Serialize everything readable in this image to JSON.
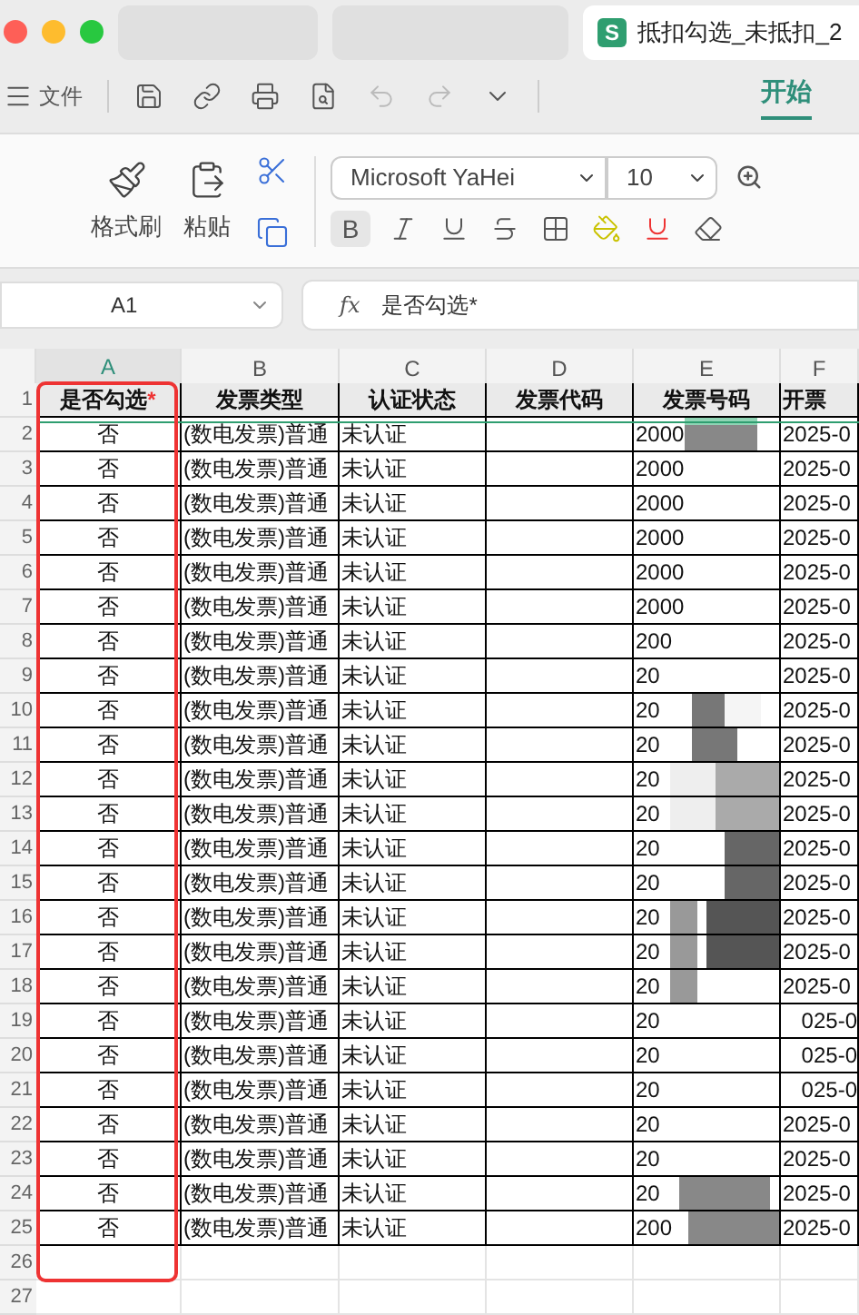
{
  "window": {
    "tab_title": "抵扣勾选_未抵扣_2",
    "app_badge": "S"
  },
  "menu": {
    "file_label": "文件",
    "ribbon_tabs": [
      {
        "label": "开始",
        "selected": true
      }
    ]
  },
  "ribbon": {
    "format_painter": "格式刷",
    "paste": "粘贴",
    "font": "Microsoft YaHei",
    "size": "10",
    "bold": "B"
  },
  "formula_bar": {
    "cell_ref": "A1",
    "fx": "fx",
    "value": "是否勾选*"
  },
  "columns": [
    {
      "letter": "A",
      "selected": true
    },
    {
      "letter": "B",
      "selected": false
    },
    {
      "letter": "C",
      "selected": false
    },
    {
      "letter": "D",
      "selected": false
    },
    {
      "letter": "E",
      "selected": false
    },
    {
      "letter": "F",
      "selected": false
    }
  ],
  "header_row": {
    "number": "1",
    "cells": [
      {
        "text": "是否勾选",
        "required_mark": "*"
      },
      {
        "text": "发票类型"
      },
      {
        "text": "认证状态"
      },
      {
        "text": "发票代码"
      },
      {
        "text": "发票号码"
      },
      {
        "text": "开票"
      }
    ]
  },
  "rows": [
    {
      "number": "2",
      "a": "否",
      "b": "(数电发票)普通",
      "c": "未认证",
      "e": "2000",
      "f": "2025-0"
    },
    {
      "number": "3",
      "a": "否",
      "b": "(数电发票)普通",
      "c": "未认证",
      "e": "2000",
      "f": "2025-0"
    },
    {
      "number": "4",
      "a": "否",
      "b": "(数电发票)普通",
      "c": "未认证",
      "e": "2000",
      "f": "2025-0"
    },
    {
      "number": "5",
      "a": "否",
      "b": "(数电发票)普通",
      "c": "未认证",
      "e": "2000",
      "f": "2025-0"
    },
    {
      "number": "6",
      "a": "否",
      "b": "(数电发票)普通",
      "c": "未认证",
      "e": "2000",
      "f": "2025-0"
    },
    {
      "number": "7",
      "a": "否",
      "b": "(数电发票)普通",
      "c": "未认证",
      "e": "2000",
      "f": "2025-0"
    },
    {
      "number": "8",
      "a": "否",
      "b": "(数电发票)普通",
      "c": "未认证",
      "e": "200",
      "f": "2025-0"
    },
    {
      "number": "9",
      "a": "否",
      "b": "(数电发票)普通",
      "c": "未认证",
      "e": "20",
      "f": "2025-0"
    },
    {
      "number": "10",
      "a": "否",
      "b": "(数电发票)普通",
      "c": "未认证",
      "e": "20",
      "f": "2025-0"
    },
    {
      "number": "11",
      "a": "否",
      "b": "(数电发票)普通",
      "c": "未认证",
      "e": "20",
      "f": "2025-0"
    },
    {
      "number": "12",
      "a": "否",
      "b": "(数电发票)普通",
      "c": "未认证",
      "e": "20",
      "f": "2025-0"
    },
    {
      "number": "13",
      "a": "否",
      "b": "(数电发票)普通",
      "c": "未认证",
      "e": "20",
      "f": "2025-0"
    },
    {
      "number": "14",
      "a": "否",
      "b": "(数电发票)普通",
      "c": "未认证",
      "e": "20",
      "f": "2025-0"
    },
    {
      "number": "15",
      "a": "否",
      "b": "(数电发票)普通",
      "c": "未认证",
      "e": "20",
      "f": "2025-0"
    },
    {
      "number": "16",
      "a": "否",
      "b": "(数电发票)普通",
      "c": "未认证",
      "e": "20",
      "f": "2025-0"
    },
    {
      "number": "17",
      "a": "否",
      "b": "(数电发票)普通",
      "c": "未认证",
      "e": "20",
      "f": "2025-0"
    },
    {
      "number": "18",
      "a": "否",
      "b": "(数电发票)普通",
      "c": "未认证",
      "e": "20",
      "f": "2025-0"
    },
    {
      "number": "19",
      "a": "否",
      "b": "(数电发票)普通",
      "c": "未认证",
      "e": "20",
      "f": "025-0"
    },
    {
      "number": "20",
      "a": "否",
      "b": "(数电发票)普通",
      "c": "未认证",
      "e": "20",
      "f": "025-0"
    },
    {
      "number": "21",
      "a": "否",
      "b": "(数电发票)普通",
      "c": "未认证",
      "e": "20",
      "f": "025-0"
    },
    {
      "number": "22",
      "a": "否",
      "b": "(数电发票)普通",
      "c": "未认证",
      "e": "20",
      "f": "2025-0"
    },
    {
      "number": "23",
      "a": "否",
      "b": "(数电发票)普通",
      "c": "未认证",
      "e": "20",
      "f": "2025-0"
    },
    {
      "number": "24",
      "a": "否",
      "b": "(数电发票)普通",
      "c": "未认证",
      "e": "20",
      "f": "2025-0"
    },
    {
      "number": "25",
      "a": "否",
      "b": "(数电发票)普通",
      "c": "未认证",
      "e": "200",
      "f": "2025-0"
    }
  ],
  "empty_rows": [
    "26",
    "27"
  ]
}
